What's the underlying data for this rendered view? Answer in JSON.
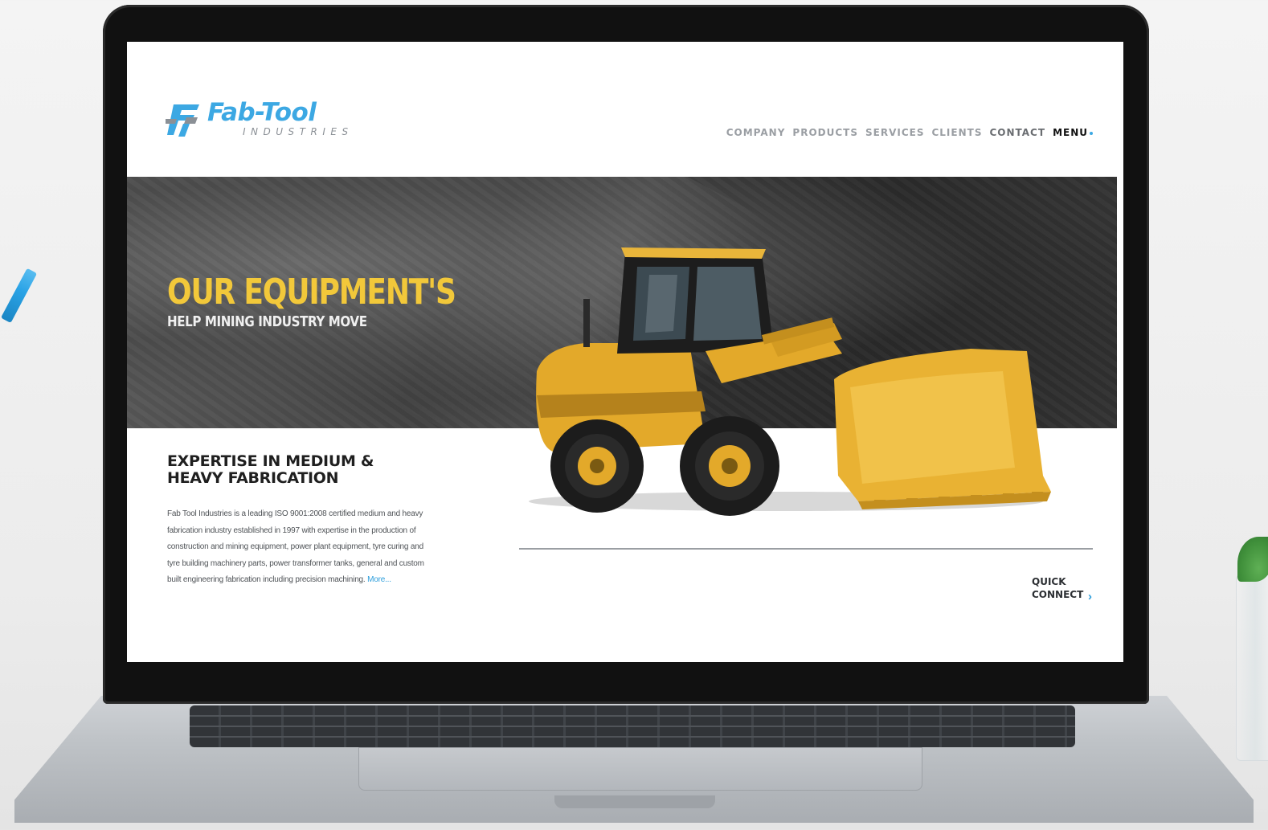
{
  "site": {
    "logo": {
      "title": "Fab-Tool",
      "subtitle": "INDUSTRIES"
    },
    "nav": {
      "company": "COMPANY",
      "products": "PRODUCTS",
      "services": "SERVICES",
      "clients": "CLIENTS",
      "contact": "CONTACT",
      "menu": "MENU"
    },
    "hero": {
      "headline": "OUR EQUIPMENT'S",
      "subheadline": "HELP MINING INDUSTRY MOVE"
    },
    "intro": {
      "title_line1": "EXPERTISE IN MEDIUM &",
      "title_line2": "HEAVY FABRICATION",
      "body": "Fab Tool Industries is a leading ISO 9001:2008 certified medium and heavy fabrication industry established in 1997 with expertise in the production of construction and mining equipment, power plant equipment, tyre curing and tyre building machinery parts, power transformer tanks, general and custom built engineering fabrication including precision machining.",
      "more_link": "More..."
    },
    "quick_connect": {
      "line1": "QUICK",
      "line2": "CONNECT",
      "icon": "chevron-right-icon"
    }
  },
  "colors": {
    "brand_blue": "#3ca8e3",
    "accent_yellow": "#f2c83a",
    "hero_dark": "#3a3a3a"
  }
}
